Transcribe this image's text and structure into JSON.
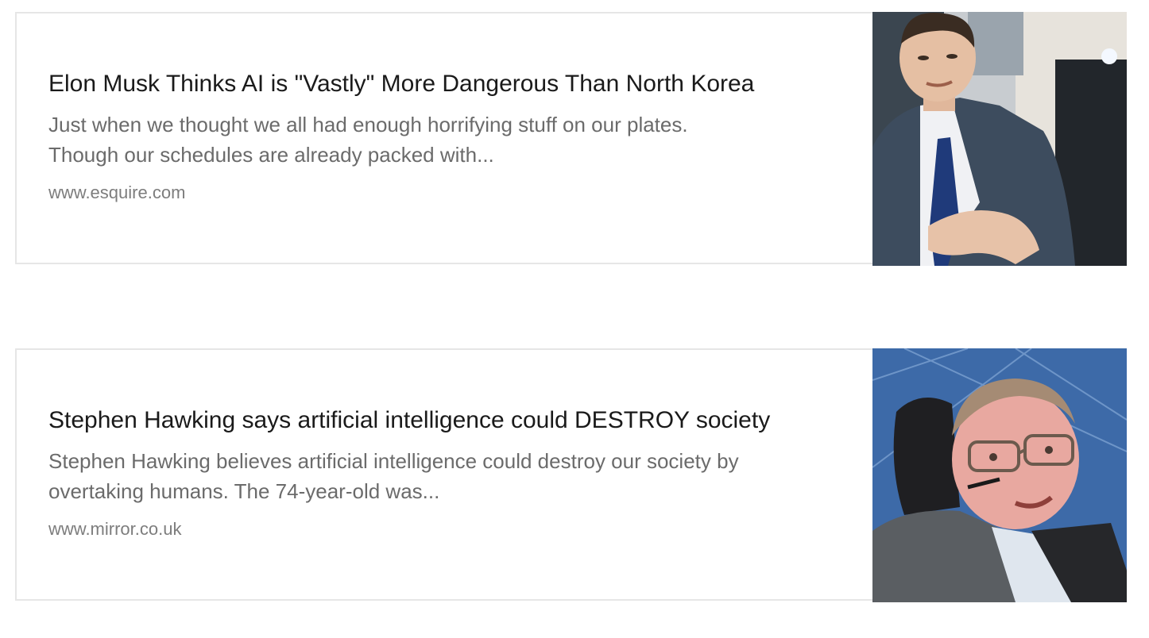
{
  "articles": [
    {
      "title": "Elon Musk Thinks AI is \"Vastly\" More Dangerous Than North Korea",
      "snippet_line1": "Just when we thought we all had enough horrifying stuff on our plates.",
      "snippet_line2": "Though our schedules are already packed with...",
      "source": "www.esquire.com",
      "thumbnail": "photo-man-in-suit-icon"
    },
    {
      "title": "Stephen Hawking says artificial intelligence could DESTROY society",
      "snippet_line1": "Stephen Hawking believes artificial intelligence could destroy our society by",
      "snippet_line2": "overtaking humans. The 74-year-old was...",
      "source": "www.mirror.co.uk",
      "thumbnail": "photo-man-with-glasses-icon"
    }
  ]
}
